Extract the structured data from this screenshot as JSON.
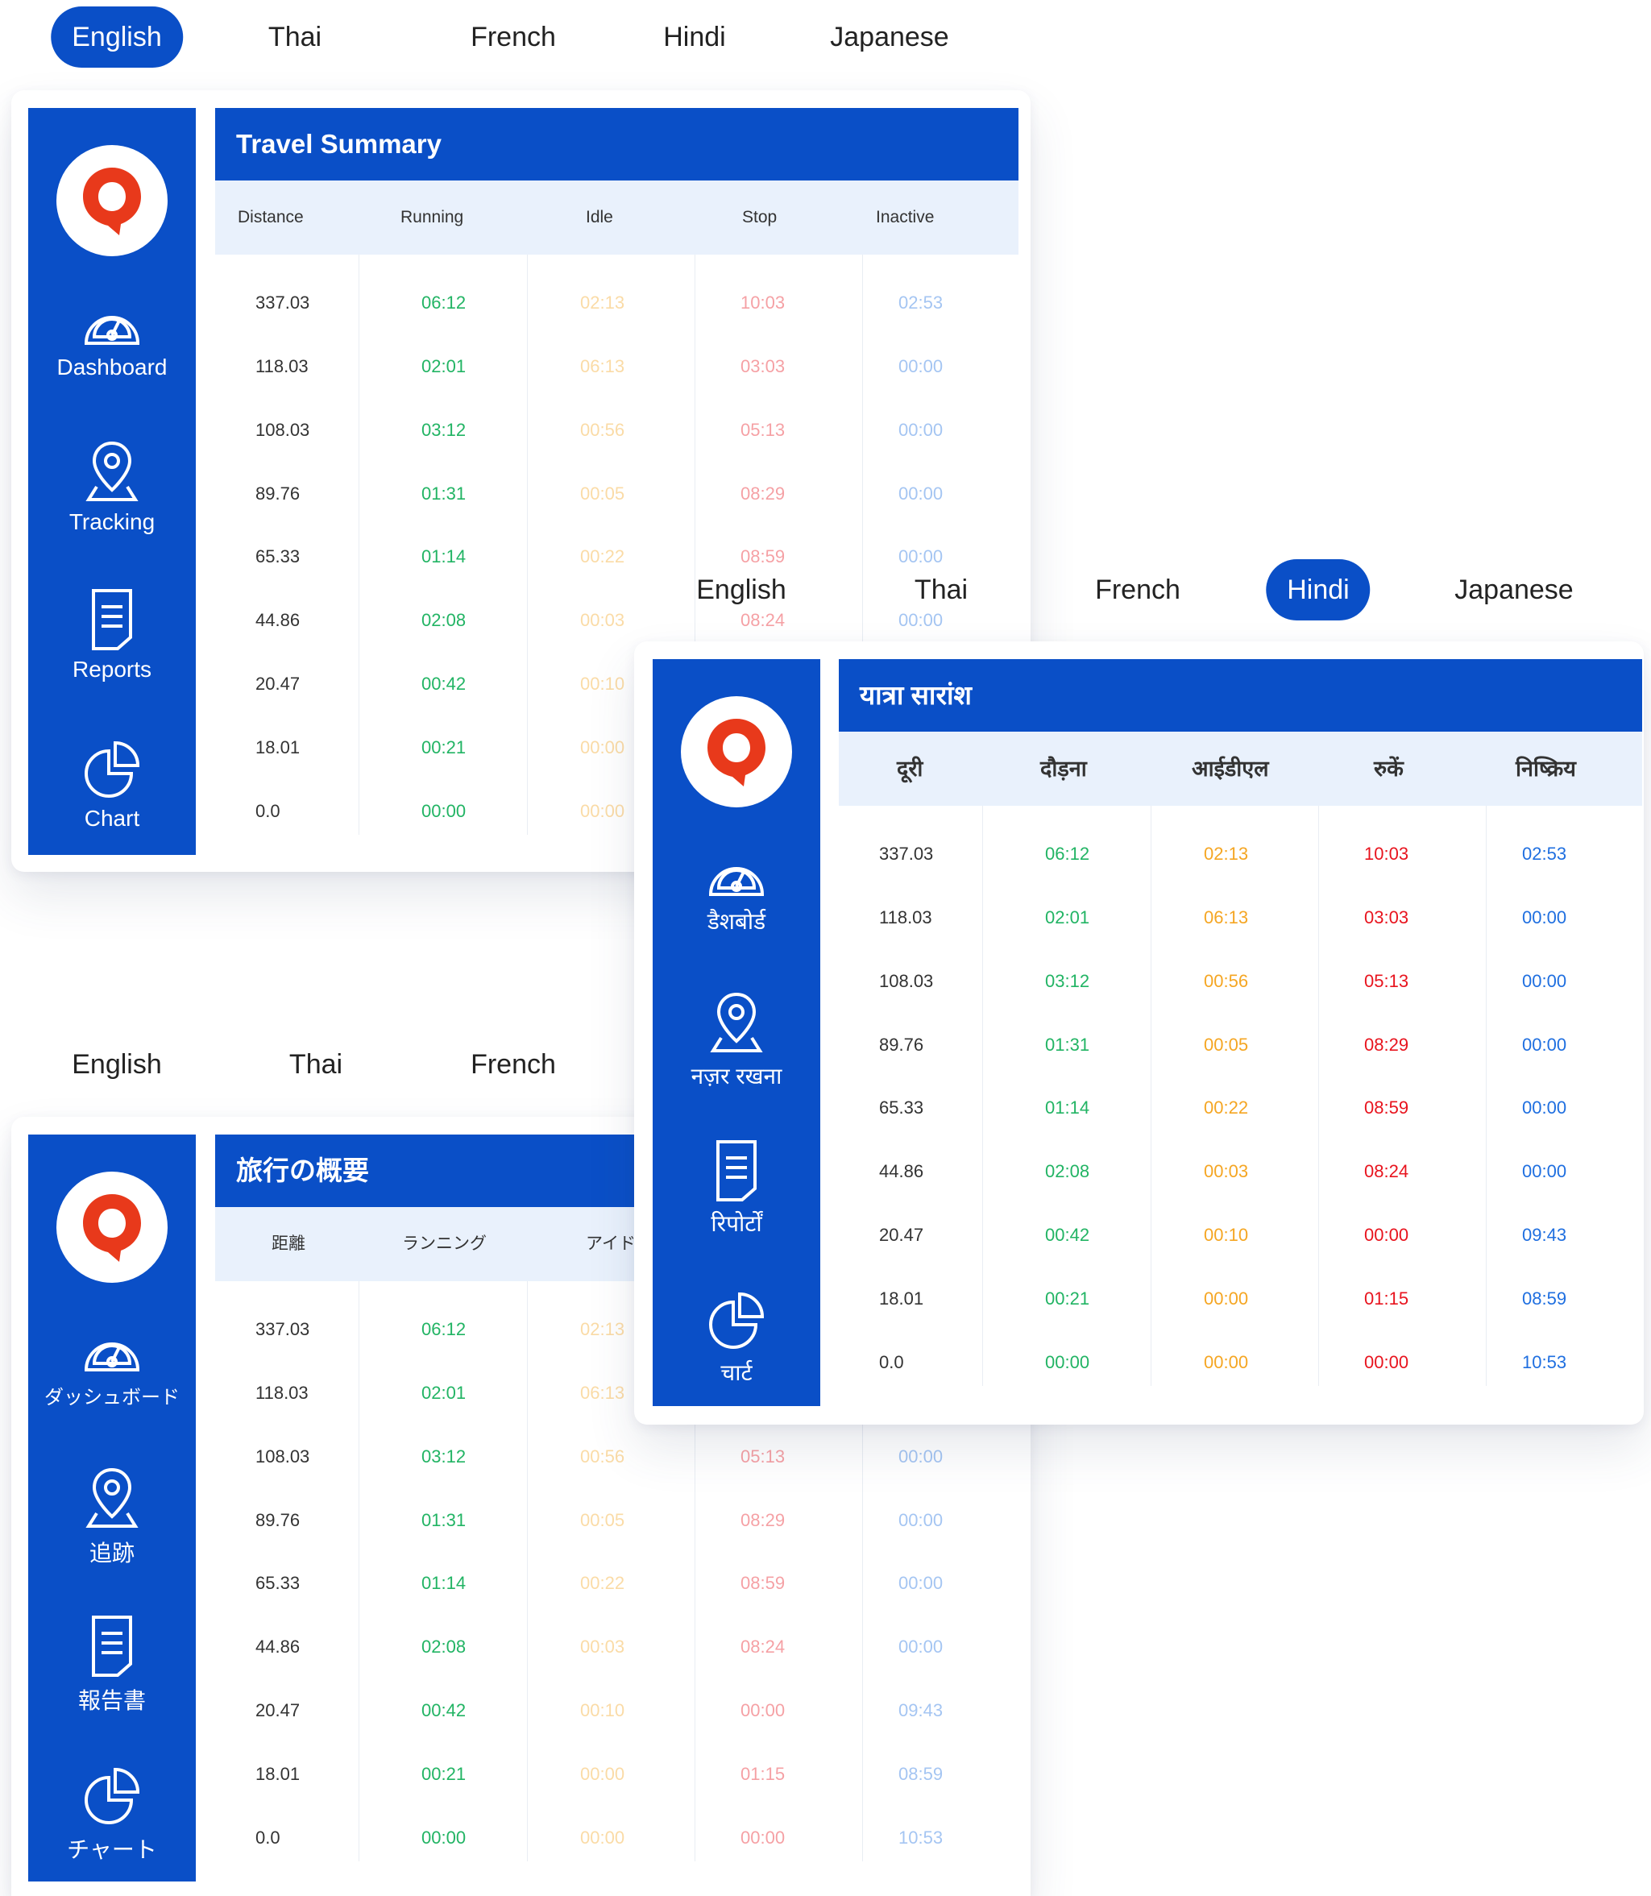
{
  "languages": [
    "English",
    "Thai",
    "French",
    "Hindi",
    "Japanese"
  ],
  "lang_bars": {
    "top": {
      "active": "English"
    },
    "middle": {
      "active": "Hindi"
    },
    "bottom": {
      "visible": [
        "English",
        "Thai",
        "French"
      ],
      "active": ""
    }
  },
  "colors": {
    "brand": "#0a4fc7",
    "header_bg": "#e9f1fc",
    "distance": "#333333",
    "running": "#22b464",
    "idle": "#f5a623",
    "stop": "#e8141e",
    "inactive": "#1f6fe0",
    "logo_pin": "#e8391b"
  },
  "cards": {
    "english": {
      "title": "Travel Summary",
      "nav": [
        "Dashboard",
        "Tracking",
        "Reports",
        "Chart"
      ],
      "columns": [
        "Distance",
        "Running",
        "Idle",
        "Stop",
        "Inactive"
      ]
    },
    "hindi": {
      "title": "यात्रा सारांश",
      "nav": [
        "डैशबोर्ड",
        "नज़र रखना",
        "रिपोर्टों",
        "चार्ट"
      ],
      "columns": [
        "दूरी",
        "दौड़ना",
        "आईडीएल",
        "रुकें",
        "निष्क्रिय"
      ]
    },
    "japanese": {
      "title": "旅行の概要",
      "nav": [
        "ダッシュボード",
        "追跡",
        "報告書",
        "チャート"
      ],
      "columns": [
        "距離",
        "ランニング",
        "アイド",
        "",
        ""
      ]
    }
  },
  "table_rows": [
    [
      "337.03",
      "06:12",
      "02:13",
      "10:03",
      "02:53"
    ],
    [
      "118.03",
      "02:01",
      "06:13",
      "03:03",
      "00:00"
    ],
    [
      "108.03",
      "03:12",
      "00:56",
      "05:13",
      "00:00"
    ],
    [
      "89.76",
      "01:31",
      "00:05",
      "08:29",
      "00:00"
    ],
    [
      "65.33",
      "01:14",
      "00:22",
      "08:59",
      "00:00"
    ],
    [
      "44.86",
      "02:08",
      "00:03",
      "08:24",
      "00:00"
    ],
    [
      "20.47",
      "00:42",
      "00:10",
      "00:00",
      "09:43"
    ],
    [
      "18.01",
      "00:21",
      "00:00",
      "01:15",
      "08:59"
    ],
    [
      "0.0",
      "00:00",
      "00:00",
      "00:00",
      "10:53"
    ]
  ],
  "icons": {
    "logo": "map-pin-logo-icon",
    "dashboard": "speedometer-icon",
    "tracking": "location-pin-icon",
    "reports": "document-icon",
    "chart": "pie-chart-icon"
  }
}
